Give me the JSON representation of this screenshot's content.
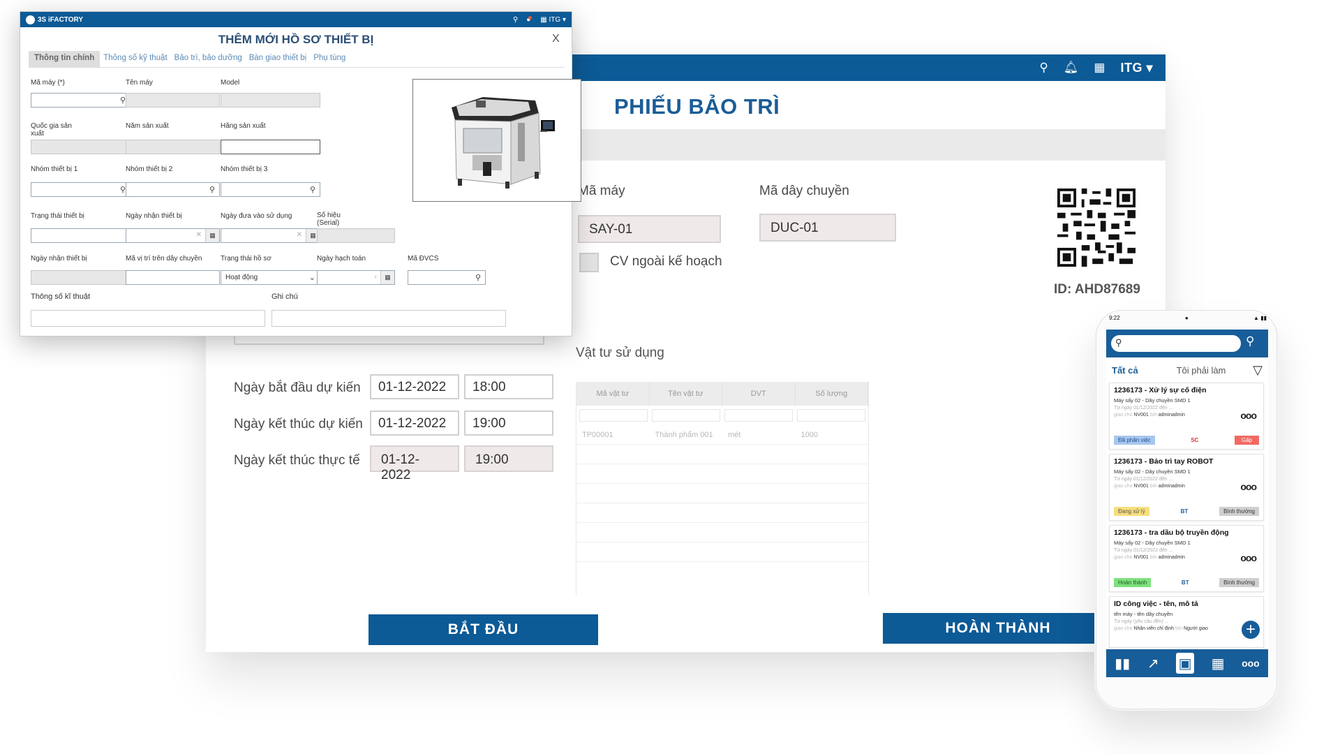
{
  "colors": {
    "brand_blue": "#0c5a96",
    "title_blue": "#1b5d97",
    "tag_assigned": "#a8c7ee",
    "tag_urgent": "#f06a63",
    "tag_processing": "#f6df7e",
    "tag_done": "#7ee07e",
    "tag_normal": "#cfcfcf"
  },
  "bg": {
    "topbar_user": "ITG",
    "title": "PHIẾU BẢO TRÌ",
    "machine_label": "Mã máy",
    "machine_value": "SAY-01",
    "line_label": "Mã dây chuyền",
    "line_value": "DUC-01",
    "cv_label": "CV ngoài kế hoạch",
    "qr_id": "ID: AHD87689",
    "start_planned_label": "Ngày bắt đầu dự kiến",
    "start_planned_date": "01-12-2022",
    "start_planned_time": "18:00",
    "end_planned_label": "Ngày kết thúc dự kiến",
    "end_planned_date": "01-12-2022",
    "end_planned_time": "19:00",
    "end_actual_label": "Ngày kết thúc thực tế",
    "end_actual_date": "01-12-2022",
    "end_actual_time": "19:00",
    "materials_title": "Vật tư sử dụng",
    "materials_headers": [
      "Mã vật tư",
      "Tên vật tư",
      "DVT",
      "Số lượng"
    ],
    "materials_rows": [
      [
        "TP00001",
        "Thành phẩm 001",
        "mét",
        "1000"
      ]
    ],
    "start_button": "BẮT ĐẦU",
    "finish_button": "HOÀN THÀNH"
  },
  "modal": {
    "brand": "3S iFACTORY",
    "user": "ITG",
    "title": "THÊM MỚI HỒ SƠ THIẾT BỊ",
    "close": "X",
    "tabs": [
      "Thông tin chính",
      "Thông số kỹ thuật",
      "Bảo trì, bảo dưỡng",
      "Bàn giao thiết bị",
      "Phụ tùng"
    ],
    "labels": {
      "ma_may": "Mã máy (*)",
      "ten_may": "Tên máy",
      "model": "Model",
      "quoc_gia": "Quốc gia sản xuất",
      "nam_sx": "Năm sản xuất",
      "hang_sx": "Hãng sản xuất",
      "nhom1": "Nhóm thiết bị 1",
      "nhom2": "Nhóm thiết bị 2",
      "nhom3": "Nhóm thiết bị 3",
      "trang_thai_tb": "Trạng thái thiết bị",
      "ngay_nhan": "Ngày nhận thiết bị",
      "ngay_dua": "Ngày đưa vào sử dụng",
      "so_hieu": "Số hiệu (Serial)",
      "ngay_nhan2": "Ngày nhận thiết bị",
      "ma_vi_tri": "Mã vị trí trên dây chuyền",
      "trang_thai_hs": "Trạng thái hồ sơ",
      "ngay_hach_toan": "Ngày hạch toán",
      "ma_dvcs": "Mã ĐVCS",
      "thong_so": "Thông số kĩ thuật",
      "ghi_chu": "Ghi chú"
    },
    "trang_thai_hs_value": "Hoạt động"
  },
  "phone": {
    "time": "9:22",
    "tab_all": "Tất cả",
    "tab_mine": "Tôi phải làm",
    "cards": [
      {
        "title": "1236173 - Xử lý sự cố điện",
        "sub": "Máy sấy 02 - Dây chuyền SMD 1",
        "date": "Từ ngày 01/12/2022 đến ...",
        "assign_pre": "giao cho",
        "assignee": "NV001",
        "assign_mid": "bởi",
        "assigner": "adminadmin",
        "status": "Đã phân việc",
        "type": "SC",
        "priority": "Gấp"
      },
      {
        "title": "1236173 - Bảo trì tay ROBOT",
        "sub": "Máy sấy 02 - Dây chuyền SMD 1",
        "date": "Từ ngày 01/12/2022 đến ...",
        "assign_pre": "giao cho",
        "assignee": "NV001",
        "assign_mid": "bởi",
        "assigner": "adminadmin",
        "status": "Đang xử lý",
        "type": "BT",
        "priority": "Bình thường"
      },
      {
        "title": "1236173 - tra dầu bộ truyền động",
        "sub": "Máy sấy 02 - Dây chuyền SMD 1",
        "date": "Từ ngày 01/12/2022 đến ...",
        "assign_pre": "giao cho",
        "assignee": "NV001",
        "assign_mid": "bởi",
        "assigner": "adminadmin",
        "status": "Hoàn thành",
        "type": "BT",
        "priority": "Bình thường"
      },
      {
        "title": "ID công việc - tên, mô tả",
        "sub": "tên máy - tên dây chuyền",
        "date": "Từ ngày (yêu cầu đến) ...",
        "assign_pre": "giao cho",
        "assignee": "Nhân viên chỉ định",
        "assign_mid": "bởi",
        "assigner": "Người giao"
      }
    ]
  }
}
